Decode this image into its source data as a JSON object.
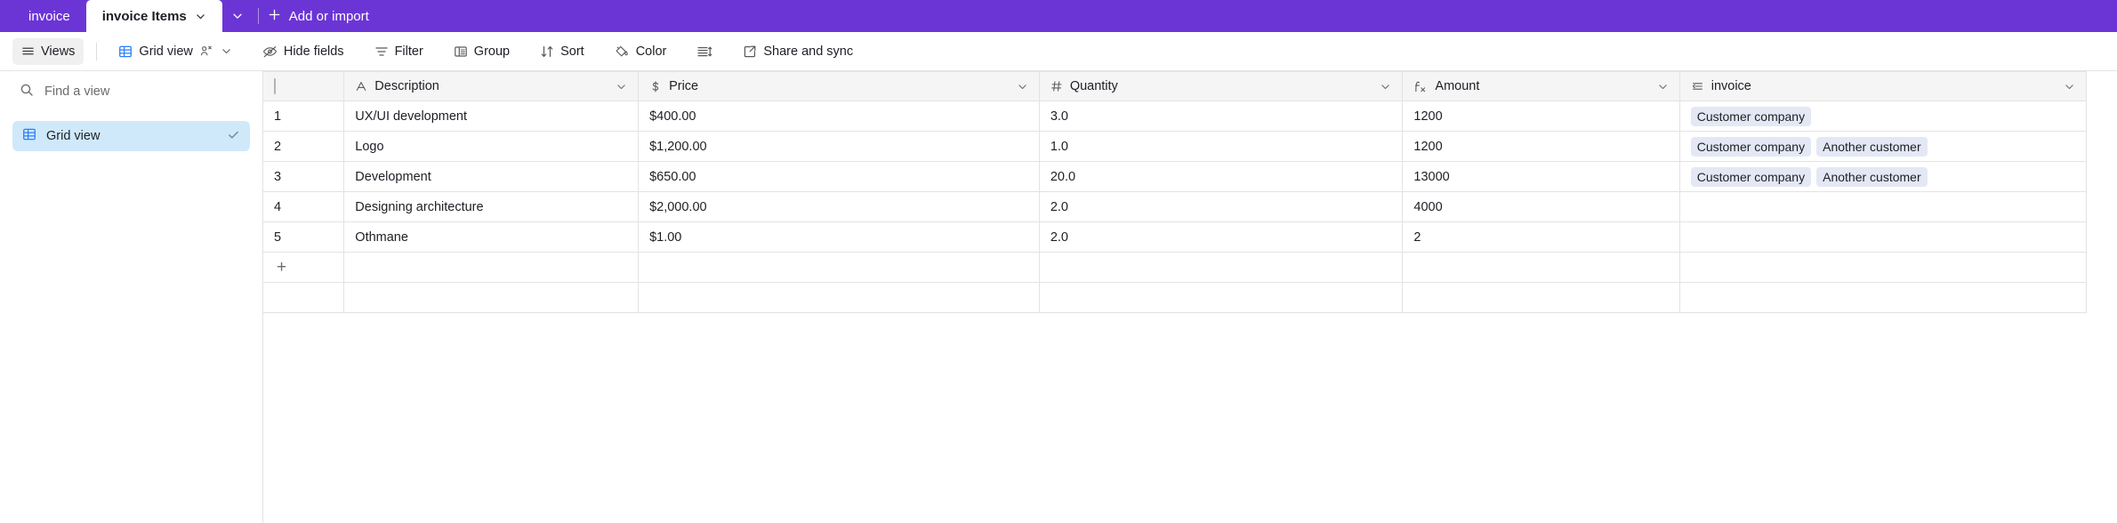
{
  "topbar": {
    "tabs": [
      {
        "label": "invoice",
        "active": false,
        "has_chevron": false
      },
      {
        "label": "invoice Items",
        "active": true,
        "has_chevron": true
      }
    ],
    "overflow_chevron": "chevron-down",
    "add_or_import": "Add or import",
    "background_color": "#6b35d6"
  },
  "toolbar": {
    "views_button": "Views",
    "grid_view_button": "Grid view",
    "hide_fields": "Hide fields",
    "filter": "Filter",
    "group": "Group",
    "sort": "Sort",
    "color": "Color",
    "row_height": "",
    "share_and_sync": "Share and sync"
  },
  "sidebar": {
    "search_placeholder": "Find a view",
    "items": [
      {
        "label": "Grid view",
        "selected": true,
        "checked": true
      }
    ]
  },
  "table": {
    "columns": [
      {
        "name": "Description",
        "type_icon": "text-a-icon",
        "align": "left"
      },
      {
        "name": "Price",
        "type_icon": "currency-dollar-icon",
        "align": "right"
      },
      {
        "name": "Quantity",
        "type_icon": "number-hash-icon",
        "align": "right"
      },
      {
        "name": "Amount",
        "type_icon": "formula-fx-icon",
        "align": "right"
      },
      {
        "name": "invoice",
        "type_icon": "linked-record-icon",
        "align": "left"
      }
    ],
    "rows": [
      {
        "num": "1",
        "description": "UX/UI development",
        "price": "$400.00",
        "quantity": "3.0",
        "amount": "1200",
        "invoice": [
          "Customer company"
        ]
      },
      {
        "num": "2",
        "description": "Logo",
        "price": "$1,200.00",
        "quantity": "1.0",
        "amount": "1200",
        "invoice": [
          "Customer company",
          "Another customer"
        ]
      },
      {
        "num": "3",
        "description": "Development",
        "price": "$650.00",
        "quantity": "20.0",
        "amount": "13000",
        "invoice": [
          "Customer company",
          "Another customer"
        ]
      },
      {
        "num": "4",
        "description": "Designing architecture",
        "price": "$2,000.00",
        "quantity": "2.0",
        "amount": "4000",
        "invoice": []
      },
      {
        "num": "5",
        "description": "Othmane",
        "price": "$1.00",
        "quantity": "2.0",
        "amount": "2",
        "invoice": []
      }
    ],
    "add_row_label": "+"
  },
  "colors": {
    "brand_purple": "#6b35d6",
    "selected_view": "#cfe9fb",
    "chip_background": "#e4e8f5",
    "grid_border": "#e3e3e3"
  }
}
